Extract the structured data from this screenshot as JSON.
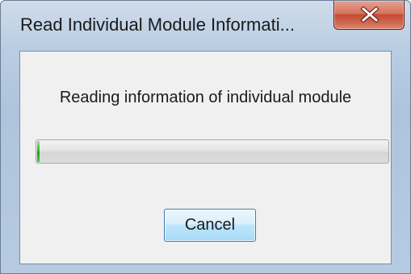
{
  "window": {
    "title": "Read Individual Module Informati...",
    "close_icon": "close-icon"
  },
  "dialog": {
    "message": "Reading information of individual module",
    "progress_fraction": 0.007,
    "progress_color": "#22b11d",
    "cancel_label": "Cancel"
  },
  "colors": {
    "close_button": "#c94f37",
    "frame": "#b9cde2",
    "client_background": "#f0f0f0"
  }
}
